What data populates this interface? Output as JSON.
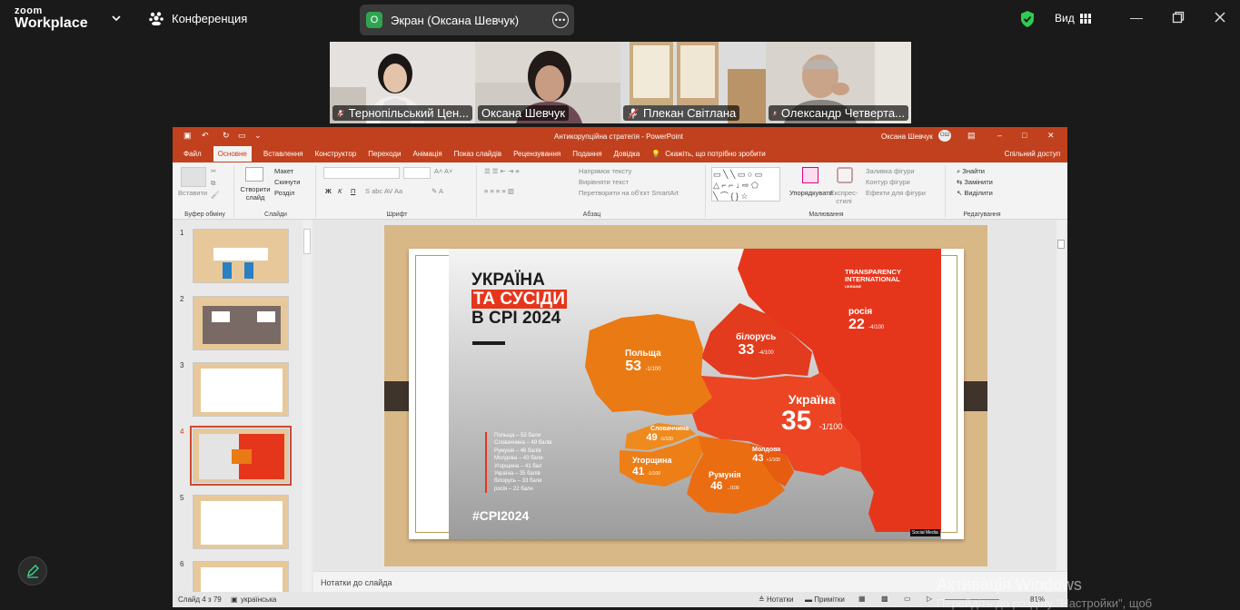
{
  "app": {
    "brand_line1": "zoom",
    "brand_line2": "Workplace",
    "meeting_label": "Конференция",
    "screen_share_label": "Экран (Оксана Шевчук)",
    "screen_share_avatar": "О",
    "view_label": "Вид"
  },
  "participants": [
    {
      "name": "Тернопільський Цен...",
      "muted": true
    },
    {
      "name": "Оксана Шевчук",
      "muted": false,
      "active": true
    },
    {
      "name": "Плекан Світлана",
      "muted": true
    },
    {
      "name": "Олександр Четверта...",
      "muted": true
    }
  ],
  "powerpoint": {
    "title": "Антикорупційна стратегія - PowerPoint",
    "user": "Оксана Шевчук",
    "user_initials": "ОШ",
    "tabs": [
      "Файл",
      "Основне",
      "Вставлення",
      "Конструктор",
      "Переходи",
      "Анімація",
      "Показ слайдів",
      "Рецензування",
      "Подання",
      "Довідка"
    ],
    "selected_tab": "Основне",
    "tell_me": "Скажіть, що потрібно зробити",
    "share": "Спільний доступ",
    "ribbon": {
      "paste": "Вставити",
      "new_slide": "Створити слайд",
      "layout": "Макет",
      "reset": "Скинути",
      "section": "Розділ",
      "bold": "Ж",
      "italic": "К",
      "underline": "П",
      "text_direction": "Напрямок тексту",
      "align_text": "Вирівняти текст",
      "smartart": "Перетворити на об'єкт SmartArt",
      "arrange": "Упорядкувати",
      "quick_styles": "Експрес-стилі",
      "fill": "Заливка фігури",
      "outline": "Контур фігури",
      "effects": "Ефекти для фігури",
      "find": "Знайти",
      "replace": "Замінити",
      "select": "Виділити",
      "groups": [
        "Буфер обміну",
        "Слайди",
        "Шрифт",
        "Абзац",
        "Малювання",
        "Редагування"
      ]
    },
    "slide_numbers": [
      "1",
      "2",
      "3",
      "4",
      "5",
      "6"
    ],
    "selected_slide": "4",
    "notes_placeholder": "Нотатки до слайда",
    "status_slide": "Слайд 4 з 79",
    "status_lang": "українська",
    "status_notes": "Нотатки",
    "status_comments": "Примітки",
    "zoom_level": "81%"
  },
  "slide": {
    "title_line1": "УКРАЇНА",
    "title_line2": "ТА СУСІДИ",
    "title_line3": "В CPI 2024",
    "hashtag": "#CPI2024",
    "ti_logo_line1": "TRANSPARENCY",
    "ti_logo_line2": "INTERNATIONAL",
    "ti_logo_line3": "UKRAINE",
    "social_media": "Social Media",
    "legend": [
      "Польща – 53 бали",
      "Словаччина – 49 балів",
      "Румунія – 46 балів",
      "Молдова – 43 бали",
      "Угорщина – 41 бал",
      "Україна – 35 балів",
      "білорусь – 33 бали",
      "росія – 22 бали"
    ],
    "countries": [
      {
        "name": "Польща",
        "score": "53",
        "delta": "-1",
        "max": "/100"
      },
      {
        "name": "білорусь",
        "score": "33",
        "delta": "-4",
        "max": "/100"
      },
      {
        "name": "росія",
        "score": "22",
        "delta": "-4",
        "max": "/100"
      },
      {
        "name": "Україна",
        "score": "35",
        "delta": "-1",
        "max": "/100"
      },
      {
        "name": "Словаччина",
        "score": "49",
        "delta": "-5",
        "max": "/100"
      },
      {
        "name": "Угорщина",
        "score": "41",
        "delta": "-1",
        "max": "/100"
      },
      {
        "name": "Румунія",
        "score": "46",
        "delta": "→",
        "max": "/100"
      },
      {
        "name": "Молдова",
        "score": "43",
        "delta": "+1",
        "max": "/100"
      }
    ]
  },
  "windows": {
    "line1": "Активація Windows",
    "line2": "Перейдіть до розділу \"Настройки\", щоб"
  },
  "colors": {
    "accent": "#c1411e",
    "zoom_green": "#3dd68c",
    "map_red": "#e5361c",
    "map_orange": "#ea7a14",
    "highlight_yellow": "#f2c200"
  }
}
